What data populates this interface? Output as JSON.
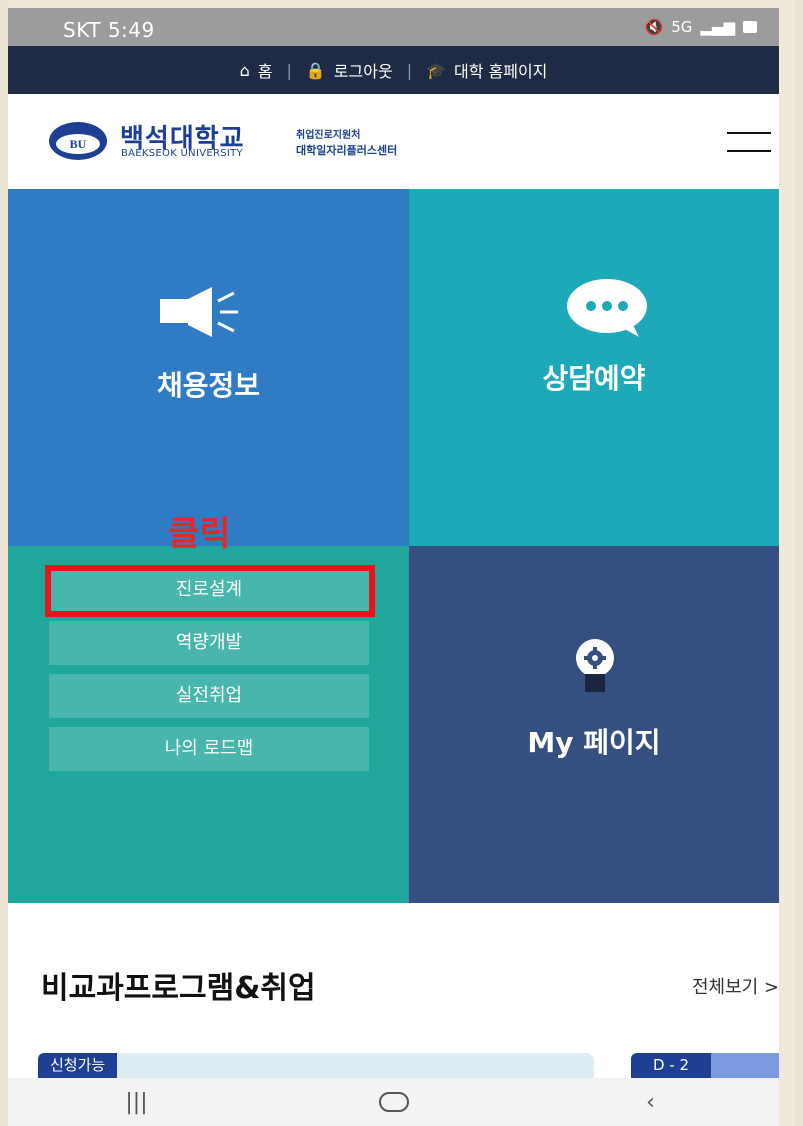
{
  "status_bar": {
    "carrier_time": "SKT 5:49",
    "network": "5G"
  },
  "util_nav": {
    "home": "홈",
    "logout": "로그아웃",
    "university_home": "대학 홈페이지"
  },
  "header": {
    "emblem_text": "BU",
    "name_kr": "백석대학교",
    "name_en": "BAEKSEOK UNIVERSITY",
    "center_line1": "취업진로지원처",
    "center_line2": "대학일자리플러스센터"
  },
  "tiles": {
    "jobs": "채용정보",
    "counsel": "상담예약",
    "mypage": "My 페이지"
  },
  "career_menu": {
    "items": [
      "진로설계",
      "역량개발",
      "실전취업",
      "나의 로드맵"
    ]
  },
  "annotation": {
    "click_label": "클릭"
  },
  "program": {
    "title": "비교과프로그램&취업",
    "view_all": "전체보기 >",
    "badge_available": "신청가능",
    "badge_dday": "D - 2"
  },
  "colors": {
    "navy": "#1f2a44",
    "brand_blue": "#1e3f92",
    "jobs_tile": "#2f7cc4",
    "counsel_tile": "#1ea9b9",
    "career_tile": "#20a69a",
    "mypage_tile": "#354f81",
    "highlight_red": "#e8141a"
  }
}
